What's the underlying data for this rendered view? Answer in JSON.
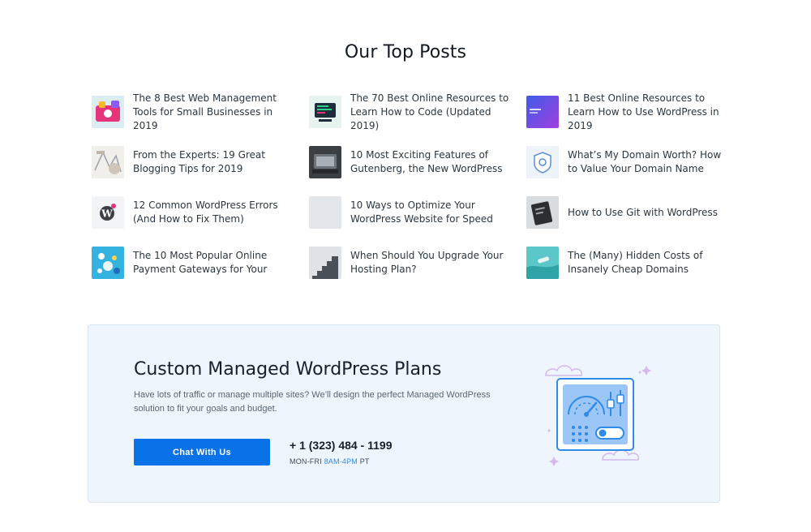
{
  "section_title": "Our Top Posts",
  "posts": [
    {
      "title": "The 8 Best Web Management Tools for Small Businesses in 2019",
      "thumb_icon": "web-tools-thumbnail"
    },
    {
      "title": "The 70 Best Online Resources to Learn How to Code (Updated 2019)",
      "thumb_icon": "code-resources-thumbnail"
    },
    {
      "title": "11 Best Online Resources to Learn How to Use WordPress in 2019",
      "thumb_icon": "wordpress-resources-thumbnail"
    },
    {
      "title": "From the Experts: 19 Great Blogging Tips for 2019",
      "thumb_icon": "blogging-tips-thumbnail"
    },
    {
      "title": "10 Most Exciting Features of Gutenberg, the New WordPress",
      "thumb_icon": "gutenberg-thumbnail"
    },
    {
      "title": "What’s My Domain Worth? How to Value Your Domain Name",
      "thumb_icon": "domain-value-thumbnail"
    },
    {
      "title": "12 Common WordPress Errors (And How to Fix Them)",
      "thumb_icon": "wordpress-errors-thumbnail"
    },
    {
      "title": "10 Ways to Optimize Your WordPress Website for Speed",
      "thumb_icon": "optimize-speed-thumbnail"
    },
    {
      "title": "How to Use Git with WordPress",
      "thumb_icon": "git-wordpress-thumbnail"
    },
    {
      "title": "The 10 Most Popular Online Payment Gateways for Your",
      "thumb_icon": "payment-gateways-thumbnail"
    },
    {
      "title": "When Should You Upgrade Your Hosting Plan?",
      "thumb_icon": "upgrade-hosting-thumbnail"
    },
    {
      "title": "The (Many) Hidden Costs of Insanely Cheap Domains",
      "thumb_icon": "cheap-domains-thumbnail"
    }
  ],
  "cta": {
    "title": "Custom Managed WordPress Plans",
    "description": "Have lots of traffic or manage multiple sites? We’ll design the perfect Managed WordPress solution to fit your goals and budget.",
    "button_label": "Chat With Us",
    "phone": "+ 1 (323) 484 - 1199",
    "hours_prefix": "MON-FRI ",
    "hours_highlight": "8AM-4PM",
    "hours_suffix": " PT",
    "illustration_icon": "dashboard-gauge-illustration"
  },
  "colors": {
    "accent": "#0a72e8",
    "cta_background": "#eef5fd",
    "hours_highlight": "#2f8ae8"
  }
}
